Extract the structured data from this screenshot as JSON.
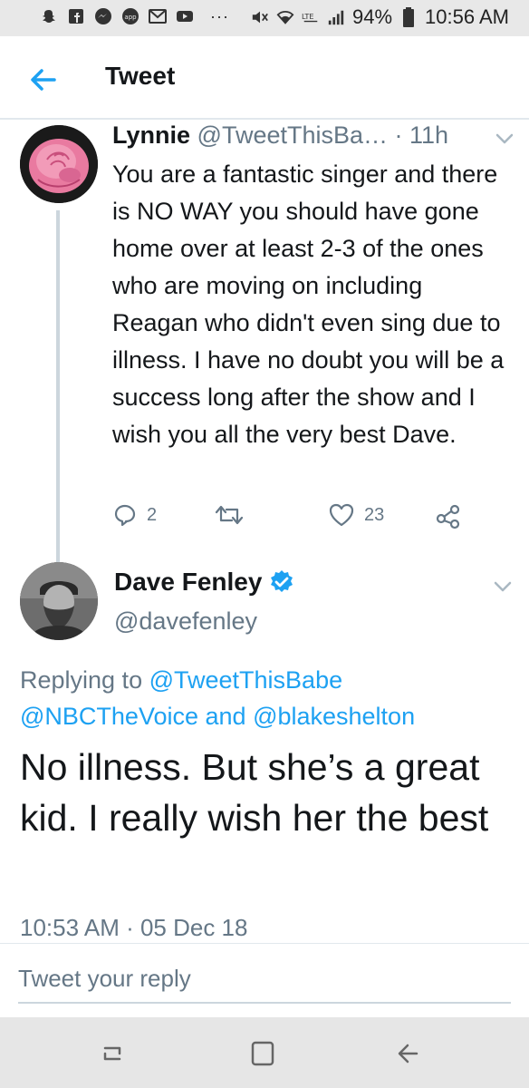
{
  "status_bar": {
    "battery": "94%",
    "time": "10:56 AM",
    "dots": "···",
    "icons": [
      "snapchat-icon",
      "facebook-icon",
      "messenger-icon",
      "app-icon",
      "gmail-icon",
      "youtube-icon",
      "mute-icon",
      "wifi-icon",
      "lte-icon",
      "signal-icon",
      "battery-icon"
    ]
  },
  "app_bar": {
    "title": "Tweet"
  },
  "tweets": [
    {
      "name": "Lynnie",
      "handle": "@TweetThisBa…",
      "time": "· 11h",
      "text": "You are a fantastic singer and there is NO WAY you should have gone home over at least 2-3 of the ones who are moving on including Reagan who didn't even sing due to illness.  I have no doubt you will be a success long after the show and I wish you all the very best Dave.",
      "replies": "2",
      "likes": "23"
    },
    {
      "name": "Dave Fenley",
      "handle": "@davefenley",
      "replying_prefix": "Replying to ",
      "mention1": "@TweetThisBabe",
      "mention2": "@NBCTheVoice",
      "and_text": " and ",
      "mention3": "@blakeshelton",
      "text": "No illness. But she’s a great kid. I really wish her the best",
      "timestamp": "10:53 AM · 05 Dec 18"
    }
  ],
  "reply_box": {
    "placeholder": "Tweet your reply"
  },
  "colors": {
    "accent": "#1da1f2",
    "secondary_text": "#657786",
    "verified": "#1da1f2"
  }
}
